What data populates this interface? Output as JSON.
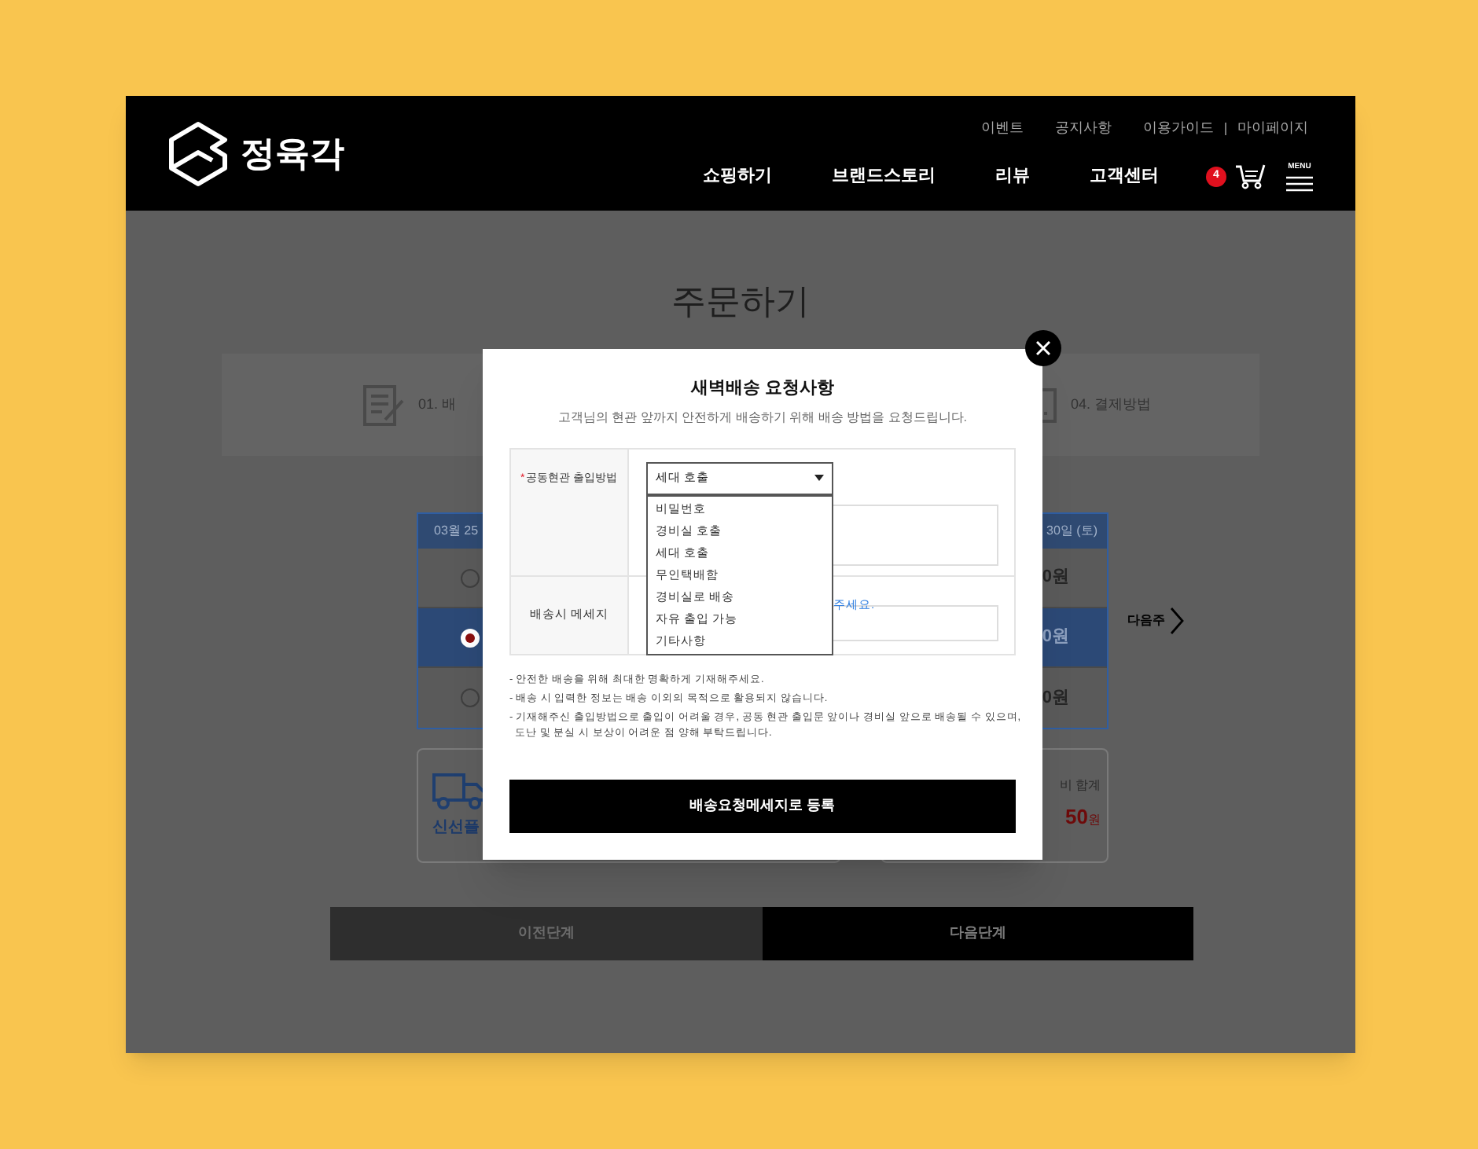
{
  "header": {
    "brand": "정육각",
    "top_links": [
      "이벤트",
      "공지사항",
      "이용가이드",
      "마이페이지"
    ],
    "nav": [
      "쇼핑하기",
      "브랜드스토리",
      "리뷰",
      "고객센터"
    ],
    "cart_count": "4",
    "menu_label": "MENU"
  },
  "page": {
    "title": "주문하기",
    "steps": [
      "01. 배",
      "04. 결제방법"
    ],
    "schedule": {
      "header_left": "03월 25",
      "header_right": "30일 (토)",
      "next_week": "다음주",
      "rows": [
        {
          "selected": false,
          "price": "0원"
        },
        {
          "selected": true,
          "price": "0원"
        },
        {
          "selected": false,
          "price": "0원"
        }
      ]
    },
    "shipping_box": {
      "label": "신선플"
    },
    "total_box": {
      "label": "비 합계",
      "amount": "50",
      "unit": "원"
    },
    "buttons": [
      {
        "label": "이전단계",
        "kind": "secondary"
      },
      {
        "label": "다음단계",
        "kind": "primary"
      }
    ]
  },
  "modal": {
    "title": "새벽배송 요청사항",
    "subtitle": "고객님의 현관 앞까지 안전하게 배송하기 위해 배송 방법을 요청드립니다.",
    "entrance": {
      "label": "공동현관 출입방법",
      "required_mark": "*",
      "value": "세대 호출",
      "expanded": true,
      "options": [
        "비밀번호",
        "경비실 호출",
        "세대 호출",
        "무인택배함",
        "경비실로 배송",
        "자유 출입 가능",
        "기타사항"
      ]
    },
    "message": {
      "label": "배송시 메세지",
      "hint": "주세요."
    },
    "notes": [
      "- 안전한 배송을 위해 최대한 명확하게 기재해주세요.",
      "- 배송 시 입력한 정보는 배송 이외의 목적으로 활용되지 않습니다.",
      "- 기재해주신 출입방법으로 출입이 어려울 경우, 공동 현관 출입문 앞이나 경비실 앞으로 배송될 수 있으며,\n  도난 및 분실 시 보상이 어려운 점 양해 부탁드립니다."
    ],
    "submit": "배송요청메세지로 등록"
  }
}
